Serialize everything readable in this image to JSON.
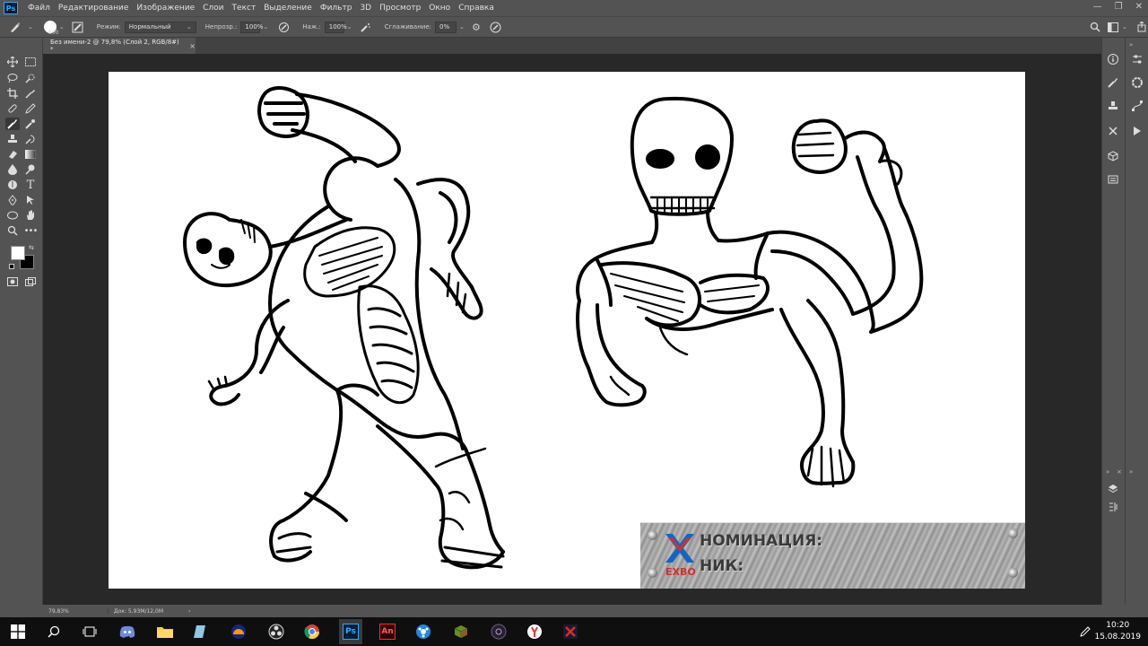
{
  "app": {
    "name": "Ps"
  },
  "menu": [
    "Файл",
    "Редактирование",
    "Изображение",
    "Слои",
    "Текст",
    "Выделение",
    "Фильтр",
    "3D",
    "Просмотр",
    "Окно",
    "Справка"
  ],
  "options": {
    "brush_size": "500",
    "mode_label": "Режим:",
    "mode_value": "Нормальный",
    "opacity_label": "Непрозр.:",
    "opacity_value": "100%",
    "flow_label": "Наж.:",
    "flow_value": "100%",
    "smoothing_label": "Сглаживание:",
    "smoothing_value": "0%"
  },
  "document": {
    "tab_title": "Без имени-2 @ 79,8% (Слой 2, RGB/8#) *",
    "close": "×"
  },
  "status": {
    "zoom": "79,83%",
    "doc_info": "Док: 5,93M/12,0M",
    "arrow": "›"
  },
  "plate": {
    "nomination_label": "НОМИНАЦИЯ:",
    "nick_label": "НИК:",
    "logo_text": "EXBO"
  },
  "taskbar": {
    "time": "10:20",
    "date": "15.08.2019"
  },
  "colors": {
    "ui_bg": "#535353",
    "canvas_bg": "#282828",
    "ps_blue": "#31a8ff",
    "exbo_red": "#d32f2f",
    "exbo_blue": "#1565c0"
  }
}
